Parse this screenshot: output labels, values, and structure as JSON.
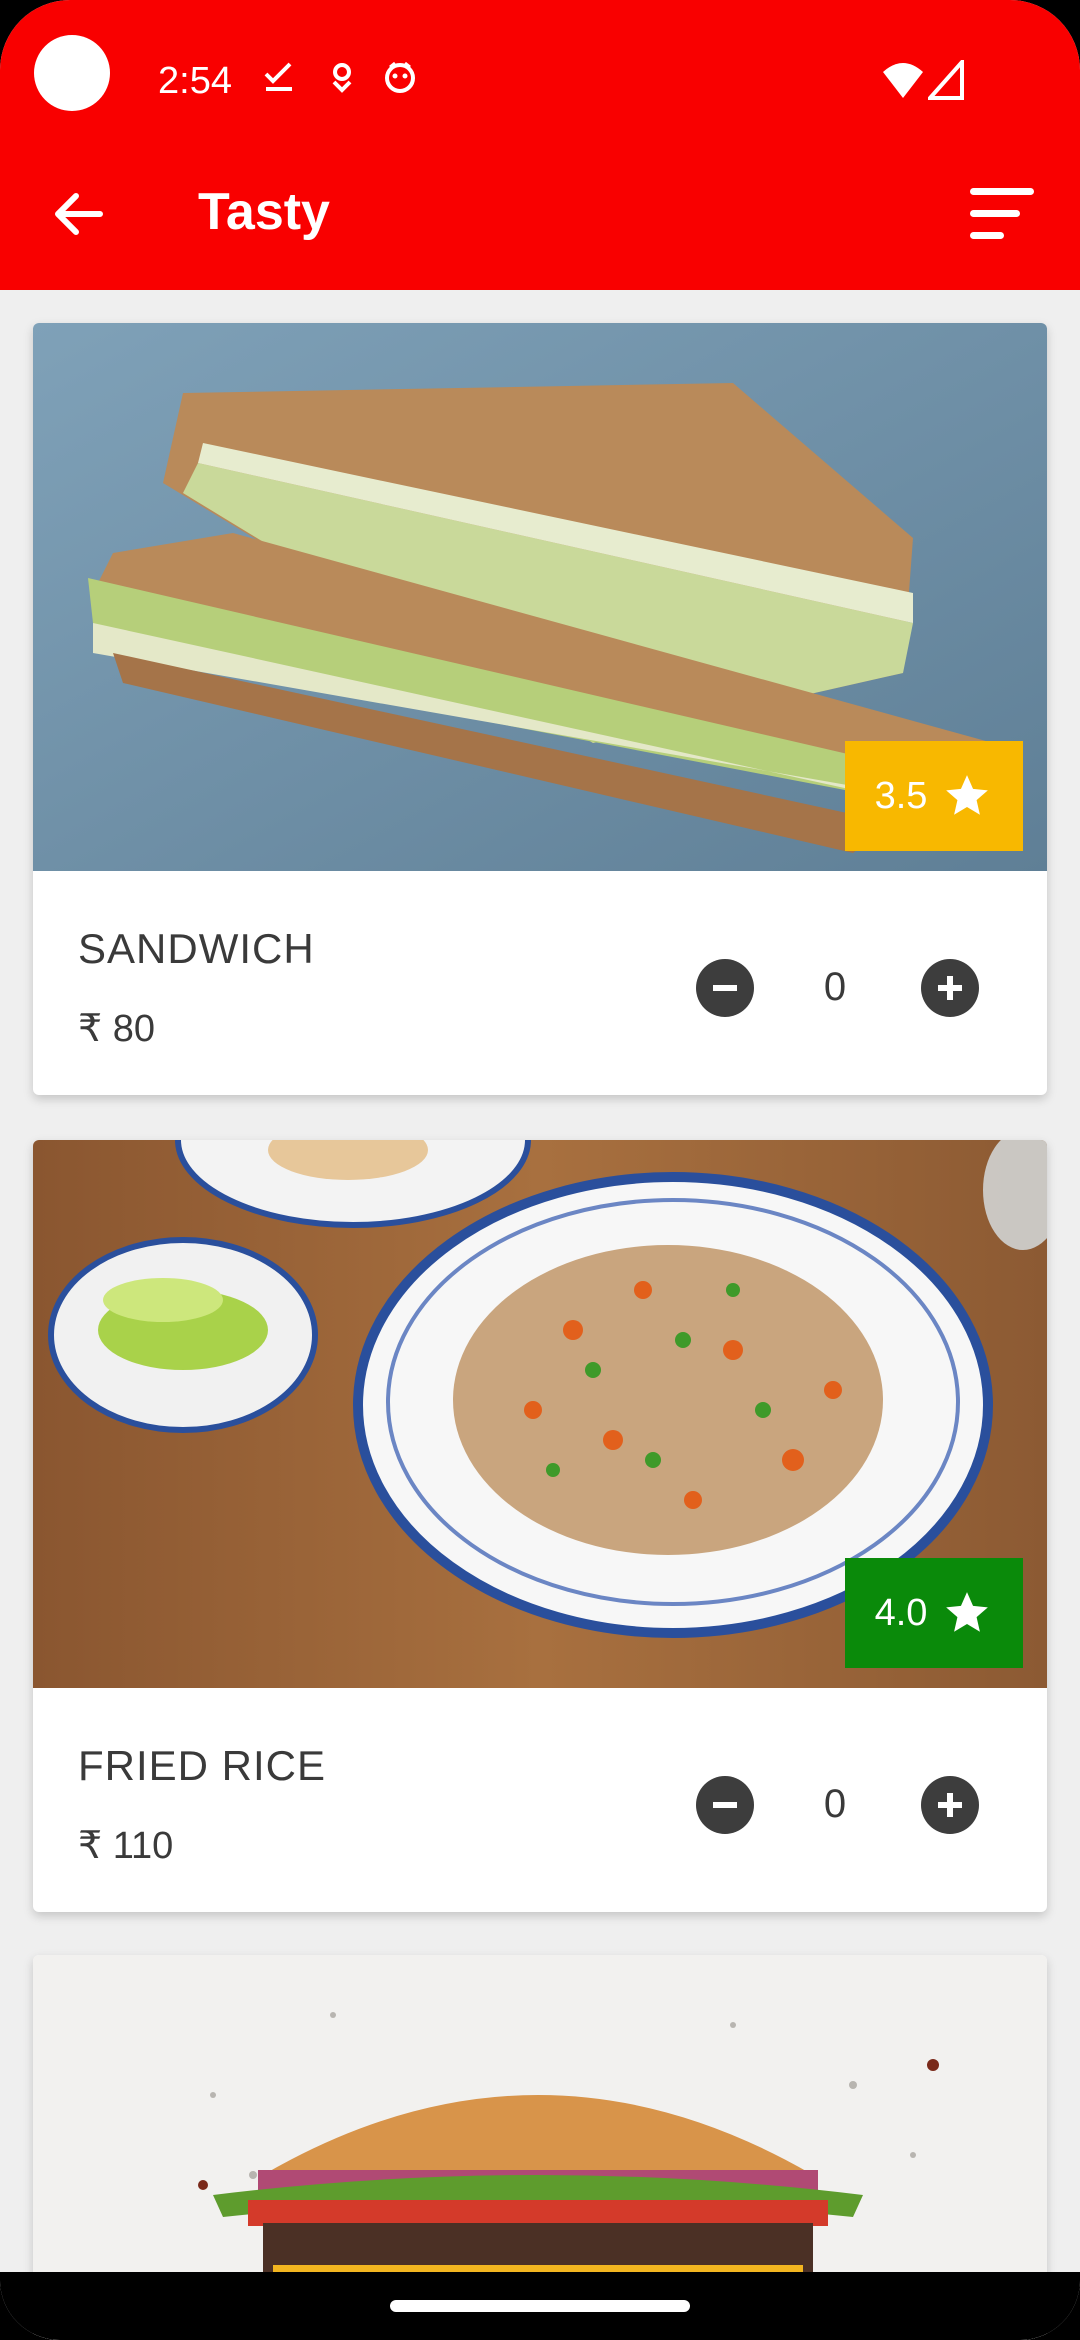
{
  "status_bar": {
    "time": "2:54"
  },
  "app_bar": {
    "title": "Tasty"
  },
  "items": [
    {
      "name": "SANDWICH",
      "price": "₹ 80",
      "rating": "3.5",
      "quantity": "0",
      "rating_color": "#f8b800"
    },
    {
      "name": "FRIED RICE",
      "price": "₹ 110",
      "rating": "4.0",
      "quantity": "0",
      "rating_color": "#0a8a0a"
    },
    {
      "name": "",
      "price": "",
      "rating": "",
      "quantity": ""
    }
  ],
  "colors": {
    "accent": "#f90000",
    "button": "#3d3d3d"
  }
}
